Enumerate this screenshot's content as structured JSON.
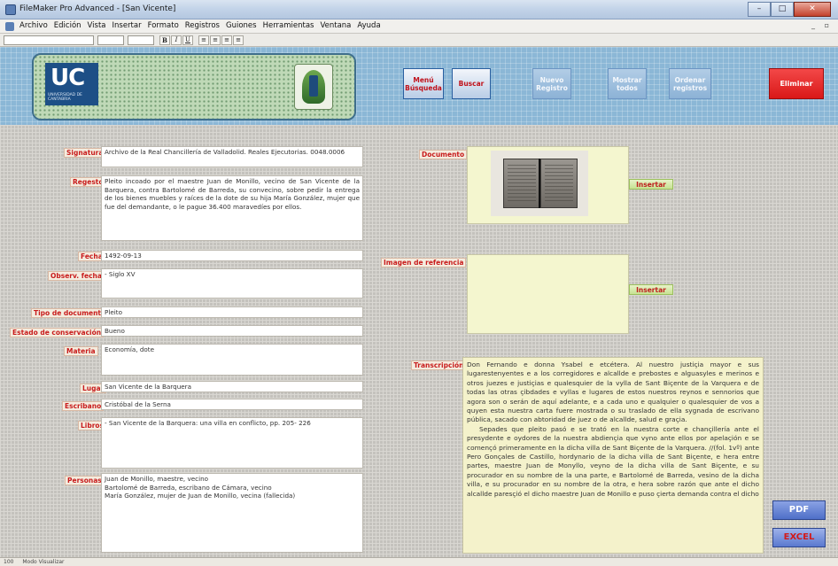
{
  "window": {
    "title": "FileMaker Pro Advanced - [San Vicente]",
    "min_label": "–",
    "max_label": "□",
    "close_label": "✕"
  },
  "menu": [
    "Archivo",
    "Edición",
    "Vista",
    "Insertar",
    "Formato",
    "Registros",
    "Guiones",
    "Herramientas",
    "Ventana",
    "Ayuda"
  ],
  "toolbar": {
    "bold": "B",
    "italic": "I",
    "underline": "U"
  },
  "header": {
    "logo_text": "UC",
    "logo_sub": "UNIVERSIDAD DE CANTABRIA",
    "buttons": {
      "menu_busqueda": "Menú Búsqueda",
      "buscar": "Buscar",
      "nuevo_registro": "Nuevo Registro",
      "mostrar_todos": "Mostrar todos",
      "ordenar_registros": "Ordenar registros",
      "eliminar": "Eliminar"
    }
  },
  "labels": {
    "signatura": "Signatura",
    "regesto": "Regesto",
    "fecha": "Fecha",
    "observ_fecha": "Observ. fecha",
    "tipo_documento": "Tipo de documento",
    "estado_conservacion": "Estado de conservación",
    "materia": "Materia",
    "lugar": "Lugar",
    "escribano": "Escribano",
    "libros": "Libros",
    "personas": "Personas",
    "documento": "Documento",
    "imagen_referencia": "Imagen de referencia",
    "transcripcion": "Transcripción"
  },
  "fields": {
    "signatura": "Archivo de la Real Chancillería de Valladolid. Reales Ejecutorias. 0048.0006",
    "regesto": "Pleito incoado por el maestre Juan de Monillo, vecino de San Vicente de la Barquera, contra Bartolomé de Barreda, su convecino, sobre pedir la entrega de los bienes muebles y raíces de la dote de su hija María González, mujer que fue del demandante, o le pague 36.400 maravedíes por ellos.",
    "fecha": "1492-09-13",
    "observ_fecha": "- Siglo XV",
    "tipo_documento": "Pleito",
    "estado_conservacion": "Bueno",
    "materia": "Economía, dote",
    "lugar": "San Vicente de la Barquera",
    "escribano": "Cristóbal de la Serna",
    "libros": "- San Vicente de la Barquera: una villa en conflicto, pp. 205- 226",
    "personas": "Juan de Monillo, maestre, vecino\nBartolomé de Barreda, escribano de Cámara, vecino\nMaría González, mujer de Juan de Monillo, vecina (fallecida)"
  },
  "insert_label": "Insertar",
  "transcription": {
    "p1": "Don Fernando e donna Ysabel e etcétera. Al nuestro justiçia mayor e sus lugarestenyentes e a los corregidores e alcallde e prebostes e alguasyles e merinos e otros juezes e justiçias e qualesquier de la vylla de Sant Biçente de la Varquera e de todas las otras çibdades e vyllas e lugares de estos nuestros reynos e sennorios que agora son o serán de aquí adelante, e a cada uno e qualquier o qualesquier de vos a quyen esta nuestra carta fuere mostrada o su traslado de ella sygnada de escrivano pública, sacado con abtoridad de juez o de alcallde, salud e graçia.",
    "p2": "Sepades que pleito pasó e se trató en la nuestra corte e chançillería ante el presydente e oydores de la nuestra abdiençia que vyno ante ellos por apelaçión e se començó primeramente en la dicha villa de Sant Biçente de la Varquera. //(fol. 1vº) ante Pero Gonçales de Castillo, hordynario de la dicha villa de Sant Biçente, e hera entre partes, maestre Juan de Monyllo, veyno de la dicha villa de Sant Biçente, e su procurador en su nombre de la una parte, e Bartolomé de Barreda, vesino de la dicha villa, e su procurador en su nombre de la otra, e hera sobre razón que ante el dicho alcallde paresçió el dicho maestre Juan de Monillo e puso çierta demanda contra el dicho"
  },
  "export": {
    "pdf": "PDF",
    "excel": "EXCEL"
  },
  "status": {
    "zoom": "100",
    "mode": "Modo Visualizar"
  }
}
